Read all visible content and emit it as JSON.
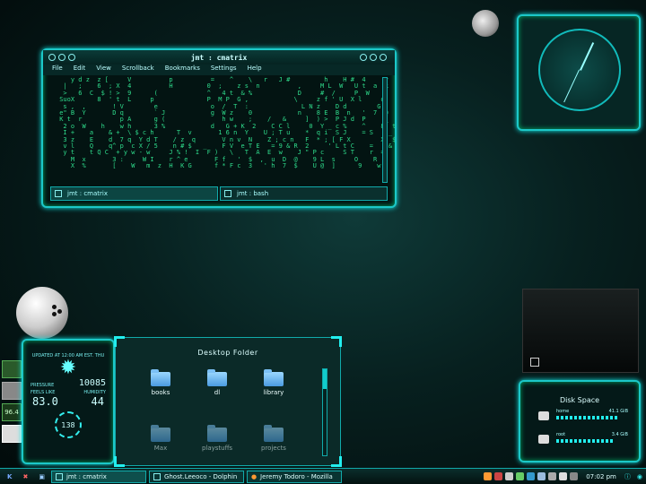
{
  "terminal": {
    "title": "jmt : cmatrix",
    "menu": [
      "File",
      "Edit",
      "View",
      "Scrollback",
      "Bookmarks",
      "Settings",
      "Help"
    ],
    "matrix_text": "    y d z  z [     V          p          =    ^    \\   r   J #         h    H #  4     v     & s          , r\n  |   ;    6  ; X  4          H         0  ;    z s  n          ,     M L  W   U t  a  k        ;  +\n  >   6  C  $ ! >  9      (             ^   4 t  & %            D     #  /     P  W        [  0  y\n SuoX      8  ' t  L     p              P  M P  G ,            \\     z f ' U  X l     o    5   L d\n  s ,  ,       ! V        e              o  /  T  :              L N z    D d        G    x   8\n e\" B  Y       D q        ` J            g  W z    0            n    8 E  B  n   '  7  Q  X  3\n K t  r          p A      g (               h w    ;    /   &     ]  ) >  P J d  P     _  K  '\n  2 o  W    h    w h      3 %            d   G + K  2    C C l     0  Y _ c %    ^    8  t  %\n  I +    a    & +  \\ $ c h      T  v       1 6 n  Y    U ; T u    *  q i  S J    = S    _ Z  2\n  3 z    E    d  7 q  Y d T    / z  q       V n v  N    Z ; c n   F  * ; [ F X        X  $  1\n  v l    Q    q^ p  c X / 5    n # $   _    F V  e T E   = 9 & R  2     ' L t C    =    &  j >\n  y t    t Q C  + y w - w     J % !  I  F )   \\   T  A  E  w    J \" P c     S T    r  =\n    M  x       3 :     W I    r ^ e       F f   '  $  ,  u  D  @    9 L  s     O    R      F\n    X  %       [    W   m  z  H  K G      f * F c  3   ' h  7  $    U @  ]      9    w    e 2  6",
    "tabs": [
      "jmt : cmatrix",
      "jmt : bash"
    ]
  },
  "weather": {
    "header": "UPDATED AT 12:00 AM EST. THU",
    "pressure_label": "PRESSURE",
    "pressure_value": "10085",
    "feels_label": "FEELS LIKE",
    "feels_value": "83.0",
    "humidity_label": "HUMIDITY",
    "humidity_value": "44",
    "wind_value": "138"
  },
  "desktop_folder": {
    "title": "Desktop Folder",
    "items": [
      {
        "label": "books"
      },
      {
        "label": "dl"
      },
      {
        "label": "library"
      },
      {
        "label": "Max"
      },
      {
        "label": "playstuffs"
      },
      {
        "label": "projects"
      }
    ]
  },
  "left_strip": {
    "label": "96.4"
  },
  "disk_space": {
    "title": "Disk Space",
    "drives": [
      {
        "name": "home",
        "size": "41.1 GiB",
        "fill": 0.85
      },
      {
        "name": "root",
        "size": "3.4 GiB",
        "fill": 0.8
      }
    ]
  },
  "taskbar": {
    "tasks": [
      "jmt : cmatrix",
      "Ghost.Leeoco - Dolphin",
      "Jeremy Todoro - Mozilla"
    ],
    "clock": "07:02 pm"
  }
}
